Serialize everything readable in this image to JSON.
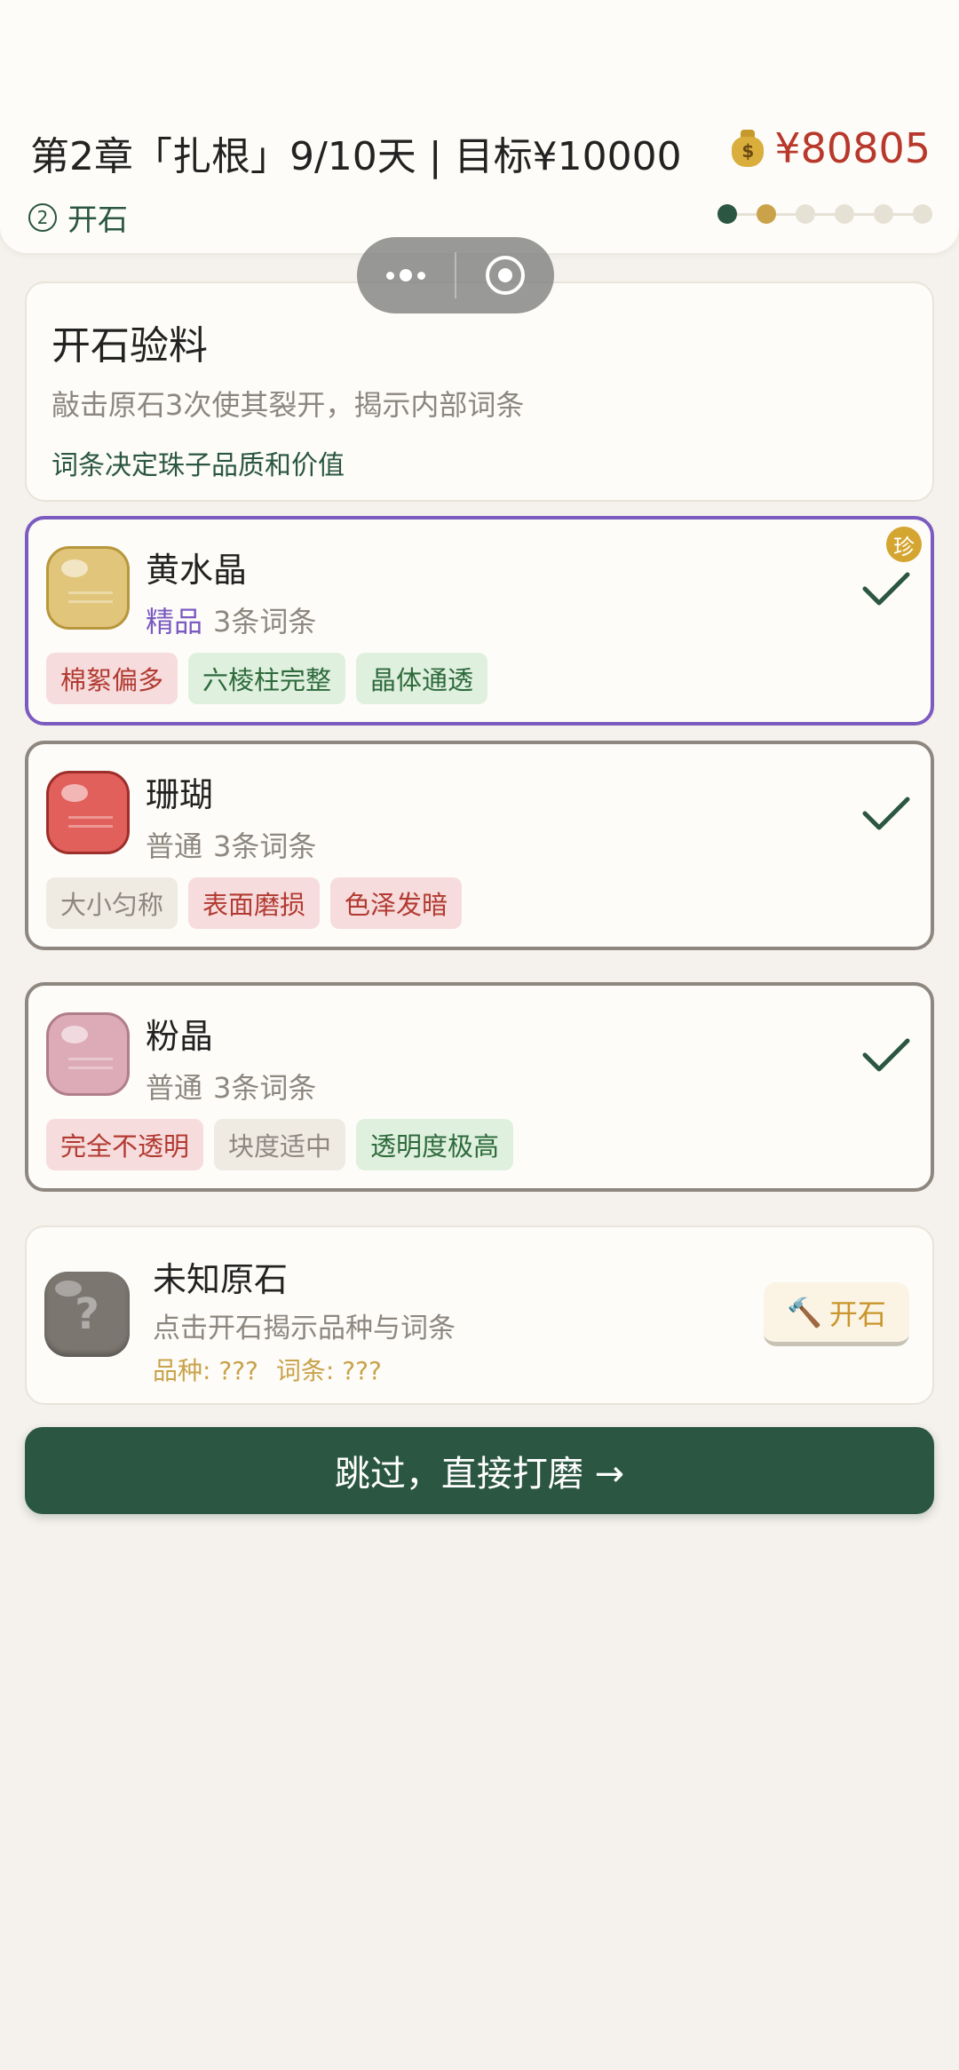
{
  "header": {
    "title": "第2章「扎根」9/10天 | 目标¥10000",
    "money": "¥80805",
    "money_icon": "money-bag-icon",
    "stage_num": "2",
    "stage_label": "开石",
    "progress": {
      "total": 6,
      "current": 2
    }
  },
  "info": {
    "title": "开石验料",
    "desc": "敲击原石3次使其裂开，揭示内部词条",
    "note": "词条决定珠子品质和价值"
  },
  "stones": [
    {
      "name": "黄水晶",
      "grade": "精品",
      "count": "3条词条",
      "badge": "珍",
      "tags": [
        {
          "text": "棉絮偏多",
          "tone": "red"
        },
        {
          "text": "六棱柱完整",
          "tone": "green"
        },
        {
          "text": "晶体通透",
          "tone": "green"
        }
      ]
    },
    {
      "name": "珊瑚",
      "grade": "普通",
      "count": "3条词条",
      "tags": [
        {
          "text": "大小匀称",
          "tone": "gray"
        },
        {
          "text": "表面磨损",
          "tone": "red"
        },
        {
          "text": "色泽发暗",
          "tone": "red"
        }
      ]
    },
    {
      "name": "粉晶",
      "grade": "普通",
      "count": "3条词条",
      "tags": [
        {
          "text": "完全不透明",
          "tone": "red"
        },
        {
          "text": "块度适中",
          "tone": "gray"
        },
        {
          "text": "透明度极高",
          "tone": "green"
        }
      ]
    }
  ],
  "unknown": {
    "name": "未知原石",
    "desc": "点击开石揭示品种与词条",
    "variety": "品种: ???",
    "traits": "词条: ???",
    "button_icon": "🔨",
    "button_label": "开石"
  },
  "skip_label": "跳过，直接打磨 →",
  "colors": {
    "primary": "#2b5641",
    "accent_gold": "#c9a24a",
    "price_red": "#b8392c",
    "fine_purple": "#7b5bc0",
    "citrine": "#e1c57a",
    "coral": "#e2605b",
    "rose_quartz": "#ddaab8"
  }
}
